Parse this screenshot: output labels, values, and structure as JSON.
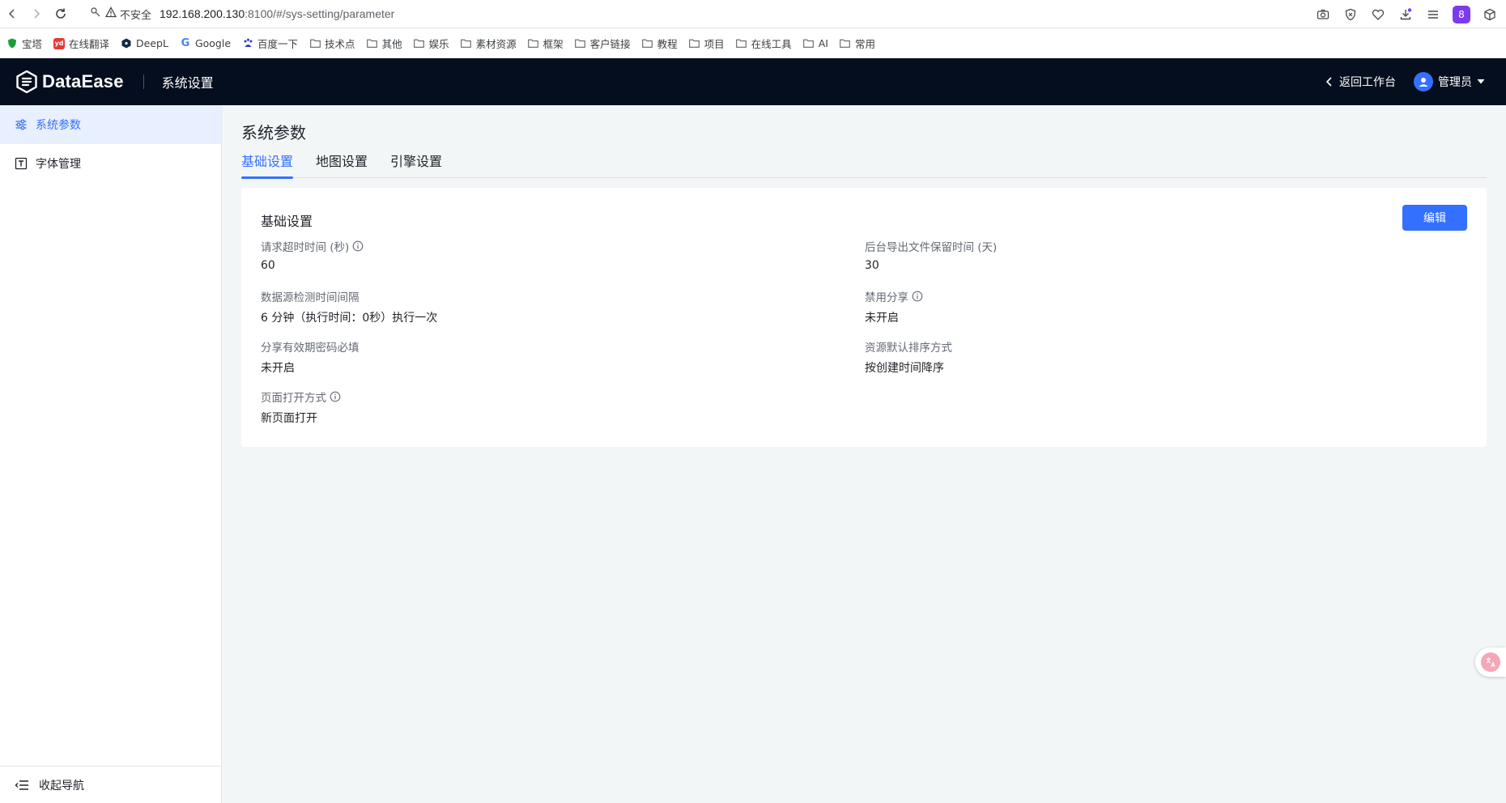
{
  "browser": {
    "insecure_label": "不安全",
    "url_host": "192.168.200.130",
    "url_path": ":8100/#/sys-setting/parameter",
    "profile_letter": "8"
  },
  "bookmarks": [
    {
      "label": "宝塔",
      "icon": "shield-icon",
      "color": "#1a9c3a"
    },
    {
      "label": "在线翻译",
      "icon": "yd-icon",
      "color": "#e53935"
    },
    {
      "label": "DeepL",
      "icon": "deepl-icon",
      "color": "#0f2b46"
    },
    {
      "label": "Google",
      "icon": "google-icon",
      "color": "#4285f4"
    },
    {
      "label": "百度一下",
      "icon": "baidu-icon",
      "color": "#2932e1"
    },
    {
      "label": "技术点",
      "icon": "folder-icon",
      "color": "#5f6368"
    },
    {
      "label": "其他",
      "icon": "folder-icon",
      "color": "#5f6368"
    },
    {
      "label": "娱乐",
      "icon": "folder-icon",
      "color": "#5f6368"
    },
    {
      "label": "素材资源",
      "icon": "folder-icon",
      "color": "#5f6368"
    },
    {
      "label": "框架",
      "icon": "folder-icon",
      "color": "#5f6368"
    },
    {
      "label": "客户链接",
      "icon": "folder-icon",
      "color": "#5f6368"
    },
    {
      "label": "教程",
      "icon": "folder-icon",
      "color": "#5f6368"
    },
    {
      "label": "项目",
      "icon": "folder-icon",
      "color": "#5f6368"
    },
    {
      "label": "在线工具",
      "icon": "folder-icon",
      "color": "#5f6368"
    },
    {
      "label": "AI",
      "icon": "folder-icon",
      "color": "#5f6368"
    },
    {
      "label": "常用",
      "icon": "folder-icon",
      "color": "#5f6368"
    }
  ],
  "header": {
    "brand": "DataEase",
    "section_title": "系统设置",
    "back_label": "返回工作台",
    "user_label": "管理员"
  },
  "sidebar": {
    "items": [
      {
        "label": "系统参数",
        "icon": "sliders-icon",
        "active": true
      },
      {
        "label": "字体管理",
        "icon": "font-box-icon",
        "active": false
      }
    ],
    "collapse_label": "收起导航"
  },
  "main": {
    "page_title": "系统参数",
    "tabs": [
      {
        "label": "基础设置",
        "active": true
      },
      {
        "label": "地图设置",
        "active": false
      },
      {
        "label": "引擎设置",
        "active": false
      }
    ],
    "card": {
      "title": "基础设置",
      "edit_label": "编辑",
      "fields": [
        {
          "label": "请求超时时间 (秒)",
          "value": "60",
          "info": true
        },
        {
          "label": "后台导出文件保留时间 (天)",
          "value": "30",
          "info": false
        },
        {
          "label": "数据源检测时间间隔",
          "value": "6 分钟（执行时间：0秒）执行一次",
          "info": false
        },
        {
          "label": "禁用分享",
          "value": "未开启",
          "info": true
        },
        {
          "label": "分享有效期密码必填",
          "value": "未开启",
          "info": false
        },
        {
          "label": "资源默认排序方式",
          "value": "按创建时间降序",
          "info": false
        },
        {
          "label": "页面打开方式",
          "value": "新页面打开",
          "info": true
        }
      ]
    }
  },
  "colors": {
    "accent": "#3370ff",
    "header_bg": "#050e1e",
    "sidebar_active_bg": "#e8f0ff"
  }
}
